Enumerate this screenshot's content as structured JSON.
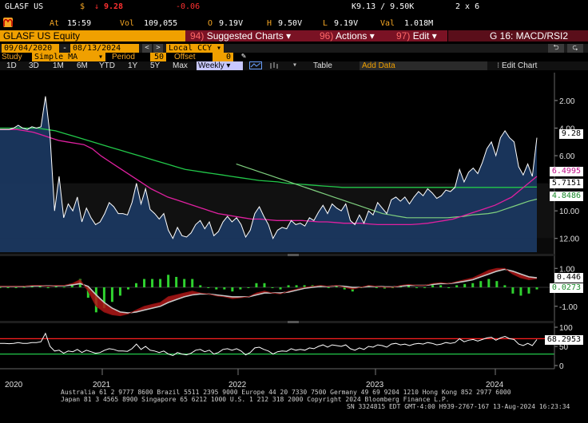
{
  "ticker_row": {
    "ticker": "GLASF US",
    "currency_symbol": "$",
    "tick": "↓",
    "last": "9.28",
    "change": "-0.06",
    "bid_ask": "K9.13 / 9.50K",
    "size": "2 x 6"
  },
  "info_row": {
    "at_label": "At",
    "time": "15:59",
    "vol_label": "Vol",
    "volume": "109,055",
    "open_label": "O",
    "open": "9.19V",
    "high_label": "H",
    "high": "9.50V",
    "low_label": "L",
    "low": "9.19V",
    "val_label": "Val",
    "value": "1.018M"
  },
  "menu": {
    "security": "GLASF US Equity",
    "suggested": {
      "key": "94)",
      "label": "Suggested Charts ▾"
    },
    "actions": {
      "key": "96)",
      "label": "Actions ▾"
    },
    "edit": {
      "key": "97)",
      "label": "Edit ▾"
    },
    "chart_id": "G 16: MACD/RSI2"
  },
  "range": {
    "start": "09/04/2020",
    "sep": "-",
    "end": "08/13/2024",
    "currency": "Local CCY"
  },
  "study": {
    "label": "Study",
    "value": "Simple MA",
    "period_label": "Period",
    "period": "50",
    "offset_label": "Offset",
    "offset": "0"
  },
  "toolbar": {
    "timeframes": [
      "1D",
      "3D",
      "1M",
      "6M",
      "YTD",
      "1Y",
      "5Y",
      "Max"
    ],
    "frequency": "Weekly ▾",
    "table": "Table",
    "add_data": "Add Data",
    "edit_chart": "Edit Chart"
  },
  "price_tags": {
    "last": "9.28",
    "ma1": "6.4995",
    "ma2": "5.7151",
    "ma3": "4.8486"
  },
  "macd_tags": {
    "macd": "0.446",
    "signal": "0.0273"
  },
  "rsi_tag": "68.2953",
  "price_axis": [
    "12.00",
    "10.00",
    "8.00",
    "6.00",
    "4.00",
    "2.00"
  ],
  "macd_axis": [
    "1.00",
    "-1.00"
  ],
  "rsi_axis": [
    "100",
    "50",
    "0"
  ],
  "years": [
    "2020",
    "2021",
    "2022",
    "2023",
    "2024"
  ],
  "footer": {
    "line1": "Australia 61 2 9777 8600 Brazil 5511 2395 9000 Europe 44 20 7330 7500 Germany 49 69 9204 1210 Hong Kong 852 2977 6000",
    "line2": "Japan 81 3 4565 8900        Singapore 65 6212 1000        U.S. 1 212 318 2000              Copyright 2024 Bloomberg Finance L.P.",
    "line3": "SN 3324815 EDT  GMT-4:00 H939-2767-167 13-Aug-2024 16:23:34"
  },
  "colors": {
    "price_fill": "#1c3a64",
    "price_line": "#ffffff",
    "ma_fast": "#e020a0",
    "ma_mid": "#22c84a",
    "ma_slow": "#7fd07f",
    "macd_hist": "#2fd12f",
    "rsi_upper": "#ff2020",
    "rsi_lower": "#22c84a",
    "accent": "#f5a623"
  },
  "chart_data": [
    {
      "type": "area",
      "title": "GLASF US Equity",
      "x_labels": [
        "2021",
        "2022",
        "2023",
        "2024"
      ],
      "ylim": [
        1,
        13.5
      ],
      "y_ticks": [
        2,
        4,
        6,
        8,
        10,
        12
      ],
      "series": [
        {
          "values": [
            9.9,
            9.9,
            9.9,
            10.0,
            10.2,
            10.0,
            9.9,
            10.1,
            10.0,
            10.1,
            12.3,
            9.5,
            4.0,
            6.5,
            3.5,
            4.5,
            4.0,
            5.0,
            3.2,
            4.2,
            3.5,
            3.0,
            3.2,
            3.8,
            4.6,
            4.3,
            3.8,
            3.8,
            3.7,
            4.6,
            6.0,
            4.5,
            5.6,
            4.1,
            3.8,
            3.4,
            3.8,
            2.6,
            2.0,
            2.8,
            2.2,
            2.1,
            2.4,
            3.0,
            3.3,
            2.7,
            3.2,
            2.2,
            2.5,
            3.2,
            3.6,
            3.2,
            3.5,
            3.0,
            2.1,
            2.6,
            3.8,
            4.3,
            3.6,
            3.0,
            2.0,
            2.6,
            2.8,
            2.7,
            3.3,
            3.0,
            3.1,
            2.9,
            3.5,
            3.3,
            3.9,
            4.4,
            3.8,
            4.5,
            4.2,
            4.0,
            4.5,
            3.3,
            3.0,
            3.7,
            3.1,
            4.0,
            3.7,
            4.6,
            4.2,
            3.8,
            4.8,
            5.0,
            4.7,
            5.0,
            4.5,
            5.0,
            5.4,
            5.1,
            5.6,
            5.3,
            4.9,
            5.1,
            5.5,
            5.4,
            5.7,
            7.0,
            6.1,
            6.8,
            7.1,
            6.7,
            7.5,
            8.5,
            9.0,
            8.0,
            9.3,
            9.8,
            9.3,
            9.0,
            7.2,
            6.6,
            7.4,
            6.5,
            9.3
          ]
        },
        {
          "values": [
            9.9,
            9.9,
            9.9,
            9.8,
            9.7,
            9.5,
            9.3,
            9.1,
            9.0,
            8.9,
            8.8,
            8.5,
            8.0,
            7.6,
            7.2,
            6.8,
            6.4,
            6.0,
            5.6,
            5.3,
            5.0,
            4.8,
            4.6,
            4.4,
            4.2,
            4.0,
            3.8,
            3.7,
            3.6,
            3.5,
            3.4,
            3.4,
            3.35,
            3.3,
            3.3,
            3.3,
            3.3,
            3.25,
            3.2,
            3.2,
            3.15,
            3.1,
            3.1,
            3.1,
            3.05,
            3.0,
            3.0,
            3.0,
            3.0,
            3.0,
            3.05,
            3.1,
            3.2,
            3.3,
            3.4,
            3.6,
            3.8,
            4.0,
            4.2,
            4.4,
            4.7,
            5.0,
            5.5,
            6.0,
            6.5
          ]
        },
        {
          "values": [
            10.0,
            10.0,
            10.0,
            10.0,
            10.0,
            9.9,
            9.8,
            9.6,
            9.4,
            9.2,
            9.0,
            8.8,
            8.6,
            8.4,
            8.2,
            8.0,
            7.8,
            7.6,
            7.4,
            7.2,
            7.0,
            6.9,
            6.8,
            6.7,
            6.6,
            6.5,
            6.4,
            6.3,
            6.2,
            6.15,
            6.1,
            6.0,
            5.95,
            5.9,
            5.85,
            5.8,
            5.75,
            5.7,
            5.7,
            5.7,
            5.7,
            5.7,
            5.7,
            5.7,
            5.7,
            5.7,
            5.7,
            5.7,
            5.7,
            5.7,
            5.7,
            5.7,
            5.7,
            5.7,
            5.7,
            5.7,
            5.7,
            5.72,
            5.72
          ]
        },
        {
          "values": [
            7.4,
            7.2,
            7.0,
            6.8,
            6.6,
            6.4,
            6.2,
            6.0,
            5.8,
            5.6,
            5.4,
            5.2,
            5.0,
            4.8,
            4.6,
            4.4,
            4.2,
            4.0,
            3.8,
            3.7,
            3.6,
            3.5,
            3.5,
            3.5,
            3.5,
            3.5,
            3.5,
            3.55,
            3.6,
            3.7,
            3.75,
            3.8,
            3.9,
            4.1,
            4.3,
            4.5,
            4.7,
            4.85
          ]
        }
      ]
    },
    {
      "type": "line",
      "title": "MACD",
      "ylim": [
        -1.6,
        1.6
      ],
      "y_ticks": [
        1,
        -1
      ],
      "series": [
        {
          "values": [
            0.05,
            0.05,
            0.05,
            0.06,
            0.1,
            0.1,
            0.05,
            0.1,
            0.1,
            0.2,
            0.4,
            -0.2,
            -1.0,
            -1.3,
            -1.45,
            -1.5,
            -1.4,
            -1.2,
            -1.0,
            -0.9,
            -0.8,
            -0.5,
            -0.4,
            -0.3,
            -0.2,
            -0.3,
            -0.35,
            -0.45,
            -0.5,
            -0.6,
            -0.55,
            -0.5,
            -0.3,
            -0.2,
            -0.3,
            -0.35,
            -0.2,
            -0.1,
            0.0,
            0.05,
            0.1,
            0.05,
            0.1,
            0.0,
            -0.1,
            0.0,
            0.1,
            0.05,
            0.0,
            0.0,
            0.1,
            0.15,
            0.1,
            0.1,
            0.2,
            0.25,
            0.2,
            0.3,
            0.4,
            0.5,
            0.7,
            0.9,
            1.0,
            1.0,
            0.7,
            0.5,
            0.4,
            0.45
          ]
        },
        {
          "values": [
            0.05,
            0.05,
            0.05,
            0.05,
            0.07,
            0.08,
            0.07,
            0.08,
            0.09,
            0.12,
            0.2,
            0.05,
            -0.4,
            -0.8,
            -1.1,
            -1.3,
            -1.35,
            -1.3,
            -1.2,
            -1.1,
            -1.0,
            -0.8,
            -0.65,
            -0.5,
            -0.4,
            -0.35,
            -0.35,
            -0.4,
            -0.45,
            -0.5,
            -0.5,
            -0.5,
            -0.4,
            -0.3,
            -0.3,
            -0.3,
            -0.25,
            -0.15,
            -0.05,
            0.0,
            0.05,
            0.05,
            0.08,
            0.05,
            0.0,
            0.0,
            0.05,
            0.05,
            0.03,
            0.02,
            0.06,
            0.1,
            0.1,
            0.1,
            0.15,
            0.2,
            0.2,
            0.25,
            0.32,
            0.4,
            0.55,
            0.7,
            0.85,
            0.95,
            0.85,
            0.7,
            0.55,
            0.5
          ]
        }
      ]
    },
    {
      "type": "line",
      "title": "RSI",
      "ylim": [
        0,
        100
      ],
      "y_ticks": [
        100,
        50,
        0
      ],
      "series": [
        {
          "values": [
            58,
            58,
            57,
            58,
            60,
            58,
            58,
            60,
            60,
            62,
            84,
            50,
            38,
            40,
            32,
            38,
            36,
            42,
            34,
            40,
            36,
            32,
            34,
            40,
            44,
            42,
            38,
            38,
            37,
            44,
            56,
            42,
            50,
            40,
            38,
            34,
            38,
            30,
            26,
            34,
            30,
            28,
            32,
            40,
            42,
            36,
            40,
            30,
            34,
            42,
            44,
            40,
            44,
            38,
            28,
            34,
            46,
            48,
            42,
            38,
            30,
            36,
            38,
            37,
            44,
            40,
            42,
            40,
            46,
            44,
            50,
            54,
            48,
            54,
            52,
            50,
            54,
            44,
            40,
            46,
            42,
            50,
            48,
            54,
            52,
            48,
            56,
            58,
            54,
            56,
            52,
            56,
            58,
            56,
            60,
            58,
            54,
            56,
            60,
            58,
            60,
            70,
            62,
            66,
            68,
            64,
            68,
            72,
            74,
            66,
            72,
            76,
            70,
            68,
            56,
            52,
            58,
            52,
            68
          ]
        }
      ]
    }
  ]
}
